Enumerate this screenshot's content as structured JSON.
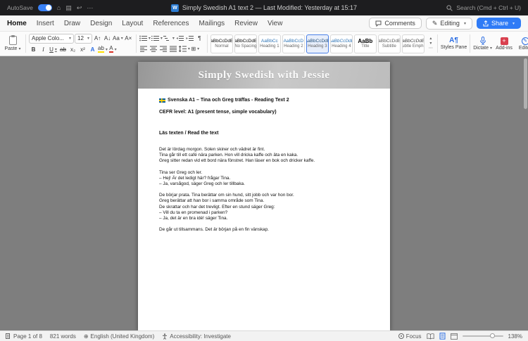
{
  "titlebar": {
    "autosave_label": "AutoSave",
    "title": "Simply Swedish A1 text 2 — Last Modified: Yesterday at 15:17",
    "search_label": "Search (Cmd + Ctrl + U)"
  },
  "icons": {
    "word_logo": "W",
    "home": "⌂",
    "save": "▤",
    "undo": "↩",
    "more": "⋯",
    "pencil": "✎",
    "globe": "⊕",
    "borders": "⊞",
    "gallery_up": "▴",
    "gallery_down": "▾",
    "gallery_more": "⋯",
    "styles_pane_glyph": "A¶",
    "addins_glyph": "+",
    "editor_glyph": "✎"
  },
  "ribbon": {
    "tabs": [
      "Home",
      "Insert",
      "Draw",
      "Design",
      "Layout",
      "References",
      "Mailings",
      "Review",
      "View"
    ],
    "active_tab": "Home",
    "comments_label": "Comments",
    "editing_label": "Editing",
    "share_label": "Share"
  },
  "toolbar": {
    "paste_label": "Paste",
    "font_name": "Apple Colo...",
    "font_size": "12",
    "formatting": {
      "grow_font": "A↑",
      "shrink_font": "A↓",
      "change_case": "Aa",
      "clear_formatting": "A×",
      "bold": "B",
      "italic": "I",
      "underline": "U",
      "strikethrough": "ab",
      "subscript": "x₂",
      "superscript": "x²",
      "text_effects": "A",
      "highlight": "ab",
      "font_color": "A",
      "pilcrow": "¶"
    },
    "styles": [
      {
        "sample": "AaBbCcDdEe",
        "name": "Normal",
        "color": "#000000"
      },
      {
        "sample": "AaBbCcDdEe",
        "name": "No Spacing",
        "color": "#000000"
      },
      {
        "sample": "AaBbCc",
        "name": "Heading 1",
        "color": "#2E74B5"
      },
      {
        "sample": "AaBbCcD",
        "name": "Heading 2",
        "color": "#2E74B5"
      },
      {
        "sample": "AaBbCcDdE",
        "name": "Heading 3",
        "color": "#1F4D78"
      },
      {
        "sample": "AaBbCcDdE",
        "name": "Heading 4",
        "color": "#2E74B5",
        "italic": true
      },
      {
        "sample": "AaBb",
        "name": "Title",
        "color": "#000000"
      },
      {
        "sample": "AaBbCcDdEe",
        "name": "Subtitle",
        "color": "#5A5A5A"
      },
      {
        "sample": "AaBbCcDdEe",
        "name": "Subtle Emph...",
        "color": "#404040",
        "italic": true
      }
    ],
    "selected_style": "Heading 3",
    "styles_pane_label": "Styles Pane",
    "dictate_label": "Dictate",
    "addins_label": "Add-ins",
    "editor_label": "Editor"
  },
  "document": {
    "banner_title": "Simply Swedish with Jessie",
    "title_line": "Svenska A1 – Tina och Greg träffas - Reading Text 2",
    "level_line": "CEFR level: A1 (present tense, simple vocabulary)",
    "instruction_line": "Läs texten / Read the text",
    "paragraphs": [
      [
        "Det är lördag morgon. Solen skiner och vädret är fint.",
        "Tina går till ett café nära parken. Hon vill dricka kaffe och äta en kaka.",
        "Greg sitter redan vid ett bord nära fönstret. Han läser en bok och dricker kaffe."
      ],
      [
        "Tina ser Greg och ler.",
        "– Hej! Är det ledigt här? frågar Tina.",
        "– Ja, varsågod, säger Greg och ler tillbaka."
      ],
      [
        "De börjar prata. Tina berättar om sin hund, sitt jobb och var hon bor.",
        "Greg berättar att han bor i samma område som Tina.",
        "De skrattar och har det trevligt. Efter en stund säger Greg:",
        "– Vill du ta en promenad i parken?",
        "– Ja, det är en bra idé! säger Tina."
      ],
      [
        "De går ut tillsammans. Det är början på en fin vänskap."
      ]
    ]
  },
  "statusbar": {
    "page": "Page 1 of 8",
    "words": "821 words",
    "language": "English (United Kingdom)",
    "accessibility": "Accessibility: Investigate",
    "focus_label": "Focus",
    "zoom": "138%"
  },
  "colors": {
    "titlebar_bg": "#1d1d1f",
    "doc_area_bg": "#7e7e7e",
    "share_blue": "#2f7bf6",
    "accent_blue": "#2b6de3",
    "heading_blue": "#2E74B5",
    "addins_red": "#d9404f"
  }
}
